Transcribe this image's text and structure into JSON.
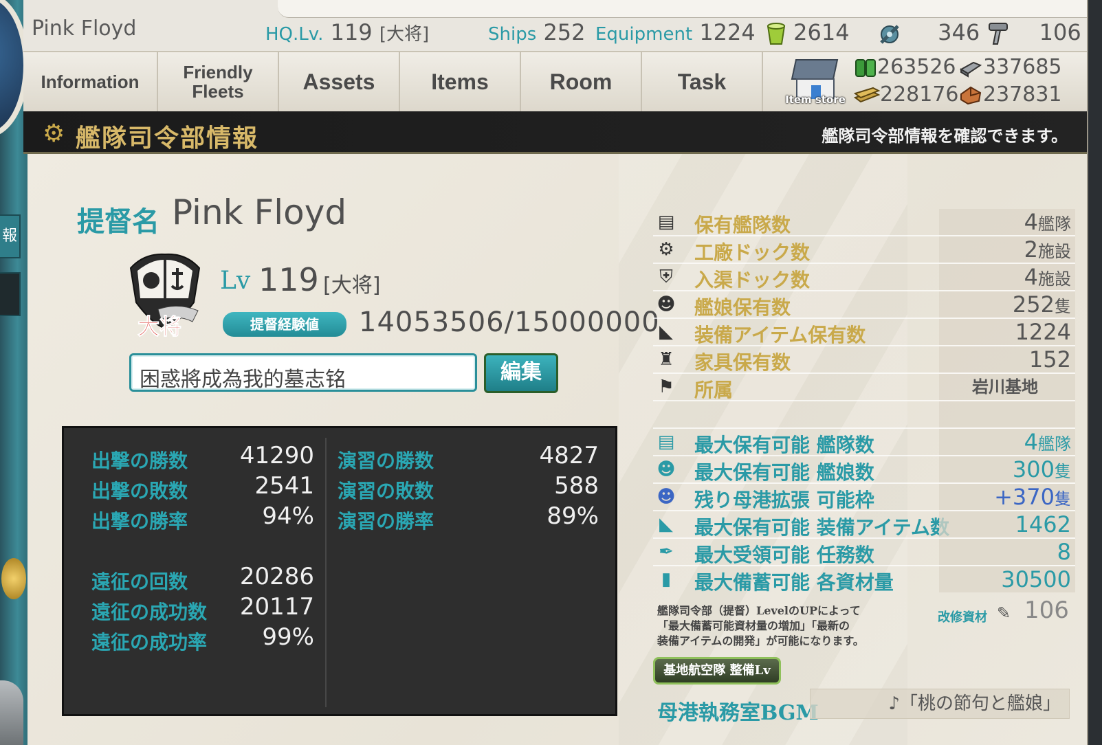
{
  "header": {
    "player_name": "Pink Floyd",
    "hq_label": "HQ.Lv.",
    "hq_level": "119",
    "hq_rank": "[大将]",
    "ships_label": "Ships",
    "ships_count": "252",
    "equipment_label": "Equipment",
    "equipment_count": "1224",
    "buckets": "2614",
    "dev_materials": "346",
    "screws": "106"
  },
  "menu": {
    "information": "Information",
    "friendly_fleets": "Friendly Fleets",
    "assets": "Assets",
    "items": "Items",
    "room": "Room",
    "task": "Task",
    "item_store": "Item store"
  },
  "materials": {
    "fuel": "263526",
    "ammo": "337685",
    "steel": "228176",
    "bauxite": "237831"
  },
  "title": {
    "main": "艦隊司令部情報",
    "sub": "艦隊司令部情報を確認できます。"
  },
  "profile": {
    "name_label": "提督名",
    "name": "Pink Floyd",
    "emblem_rank": "大将",
    "lv_label": "Lv",
    "level": "119",
    "rank": "[大将]",
    "exp_label": "提督経験値",
    "exp": "14053506/15000000",
    "comment": "困惑將成為我的墓志铭",
    "edit_label": "編集"
  },
  "record": {
    "sortie_wins_label": "出撃の勝数",
    "sortie_wins": "41290",
    "sortie_losses_label": "出撃の敗数",
    "sortie_losses": "2541",
    "sortie_rate_label": "出撃の勝率",
    "sortie_rate": "94%",
    "pvp_wins_label": "演習の勝数",
    "pvp_wins": "4827",
    "pvp_losses_label": "演習の敗数",
    "pvp_losses": "588",
    "pvp_rate_label": "演習の勝率",
    "pvp_rate": "89%",
    "exp_count_label": "遠征の回数",
    "exp_count": "20286",
    "exp_success_label": "遠征の成功数",
    "exp_success": "20117",
    "exp_rate_label": "遠征の成功率",
    "exp_rate": "99%"
  },
  "stats": {
    "fleets_label": "保有艦隊数",
    "fleets": "4",
    "fleets_unit": "艦隊",
    "construction_label": "工廠ドック数",
    "construction": "2",
    "construction_unit": "施設",
    "repair_label": "入渠ドック数",
    "repair": "4",
    "repair_unit": "施設",
    "ship_count_label": "艦娘保有数",
    "ship_count": "252",
    "ship_count_unit": "隻",
    "equip_count_label": "装備アイテム保有数",
    "equip_count": "1224",
    "furniture_label": "家具保有数",
    "furniture": "152",
    "base_label": "所属",
    "base": "岩川基地",
    "max_fleets_label": "最大保有可能 艦隊数",
    "max_fleets": "4",
    "max_fleets_unit": "艦隊",
    "max_ships_label": "最大保有可能 艦娘数",
    "max_ships": "300",
    "max_ships_unit": "隻",
    "expand_label": "残り母港拡張 可能枠",
    "expand": "+370",
    "expand_unit": "隻",
    "max_equip_label": "最大保有可能 装備アイテム数",
    "max_equip": "1462",
    "max_quests_label": "最大受領可能 任務数",
    "max_quests": "8",
    "max_resources_label": "最大備蓄可能 各資材量",
    "max_resources": "30500"
  },
  "note": {
    "line1": "艦隊司令部（提督）LevelのUPによって",
    "line2": "「最大備蓄可能資材量の増加」「最新の",
    "line3": "装備アイテムの開発」が可能になります。",
    "improve_label": "改修資材",
    "improve_value": "106"
  },
  "lbas": {
    "label": "基地航空隊 整備Lv"
  },
  "bgm": {
    "label": "母港執務室BGM",
    "value": "♪「桃の節句と艦娘」"
  }
}
